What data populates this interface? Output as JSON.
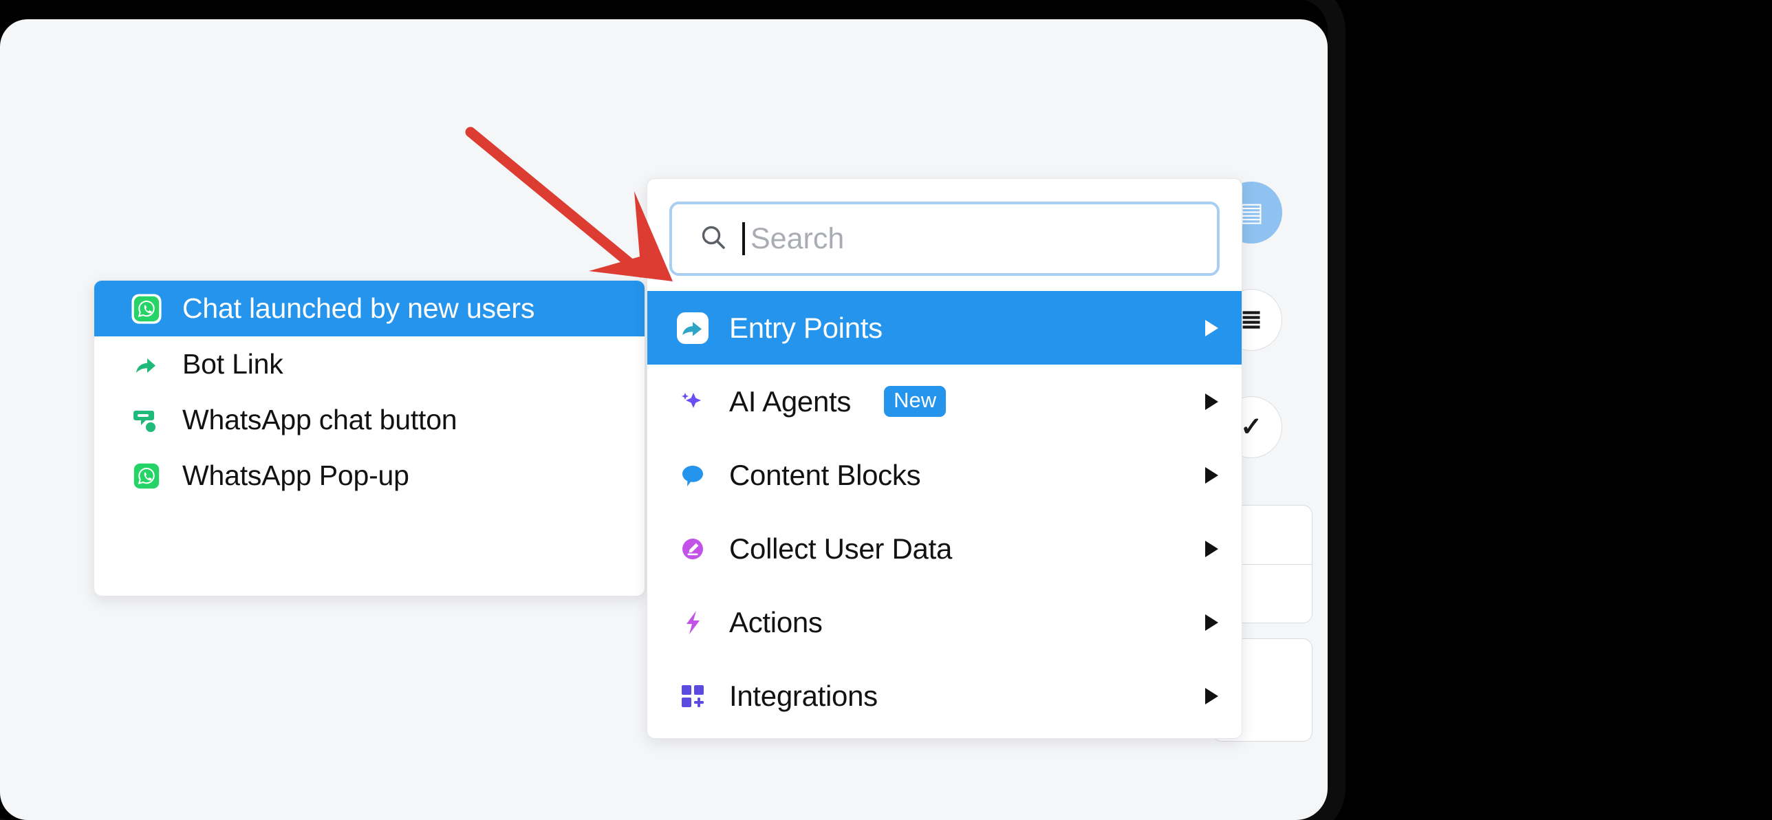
{
  "canvas": {
    "background_color": "#f5f6f7",
    "frame_color": "#0d0d0d"
  },
  "annotation": {
    "type": "arrow",
    "color": "#dc3c31",
    "points_to": "Entry Points",
    "name": "red-annotation-arrow"
  },
  "search": {
    "placeholder": "Search",
    "value": "",
    "icon": "search-icon",
    "focus_ring_color": "#a8cff2",
    "caret_visible": true
  },
  "left_panel": {
    "name": "entry-points-submenu",
    "items": [
      {
        "label": "Chat launched by new users",
        "icon": "whatsapp-icon",
        "icon_color": "#25d366",
        "selected": true
      },
      {
        "label": "Bot Link",
        "icon": "share-arrow-icon",
        "icon_color": "#1fb97a",
        "selected": false
      },
      {
        "label": "WhatsApp chat button",
        "icon": "chat-bubble-dot-icon",
        "icon_color": "#1fb97a",
        "selected": false
      },
      {
        "label": "WhatsApp Pop-up",
        "icon": "whatsapp-icon",
        "icon_color": "#25d366",
        "selected": false
      }
    ]
  },
  "right_panel": {
    "name": "block-category-menu",
    "highlight_color": "#2494ec",
    "items": [
      {
        "label": "Entry Points",
        "icon": "entry-points-arrow-icon",
        "icon_color": "#2ea5c4",
        "selected": true,
        "has_submenu": true,
        "badge": ""
      },
      {
        "label": "AI Agents",
        "icon": "sparkles-icon",
        "icon_color": "#6b4df6",
        "selected": false,
        "has_submenu": true,
        "badge": "New"
      },
      {
        "label": "Content Blocks",
        "icon": "speech-bubble-icon",
        "icon_color": "#2494ec",
        "selected": false,
        "has_submenu": true,
        "badge": ""
      },
      {
        "label": "Collect User Data",
        "icon": "pencil-circle-icon",
        "icon_color": "#c252e8",
        "selected": false,
        "has_submenu": true,
        "badge": ""
      },
      {
        "label": "Actions",
        "icon": "lightning-bolt-icon",
        "icon_color": "#c252e8",
        "selected": false,
        "has_submenu": true,
        "badge": ""
      },
      {
        "label": "Integrations",
        "icon": "grid-plus-icon",
        "icon_color": "#5b4be0",
        "selected": false,
        "has_submenu": true,
        "badge": ""
      }
    ]
  },
  "background_ui": {
    "name": "flow-builder-background",
    "round_buttons": [
      {
        "name": "bg-accent-button",
        "glyph": "▤",
        "accent": true
      },
      {
        "name": "bg-list-button",
        "glyph": "≣",
        "accent": false
      },
      {
        "name": "bg-check-button",
        "glyph": "✓",
        "accent": false
      }
    ]
  }
}
